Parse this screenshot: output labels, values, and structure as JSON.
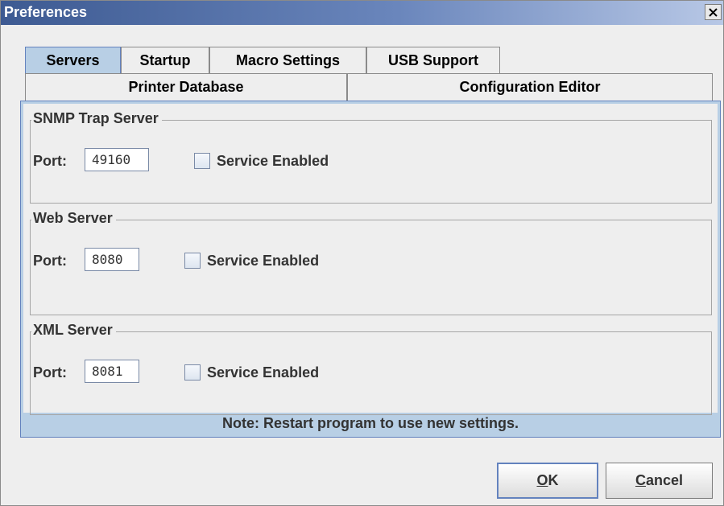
{
  "window": {
    "title": "Preferences"
  },
  "tabs_row1": [
    {
      "label": "Servers",
      "active": true
    },
    {
      "label": "Startup",
      "active": false
    },
    {
      "label": "Macro Settings",
      "active": false
    },
    {
      "label": "USB Support",
      "active": false
    }
  ],
  "tabs_row2": [
    {
      "label": "Printer Database",
      "active": false
    },
    {
      "label": "Configuration Editor",
      "active": false
    }
  ],
  "groups": [
    {
      "title": "SNMP Trap Server",
      "port_label": "Port:",
      "port_value": "49160",
      "checkbox_label": "Service Enabled",
      "checked": false
    },
    {
      "title": "Web Server",
      "port_label": "Port:",
      "port_value": "8080",
      "checkbox_label": "Service Enabled",
      "checked": false
    },
    {
      "title": "XML Server",
      "port_label": "Port:",
      "port_value": "8081",
      "checkbox_label": "Service Enabled",
      "checked": false
    }
  ],
  "note": "Note: Restart program to use new settings.",
  "buttons": {
    "ok": {
      "mnemonic": "O",
      "rest": "K"
    },
    "cancel": {
      "mnemonic": "C",
      "rest": "ancel"
    }
  },
  "colors": {
    "accent": "#6382be",
    "selected_tab": "#b8cfe5",
    "background": "#eeeeee"
  }
}
